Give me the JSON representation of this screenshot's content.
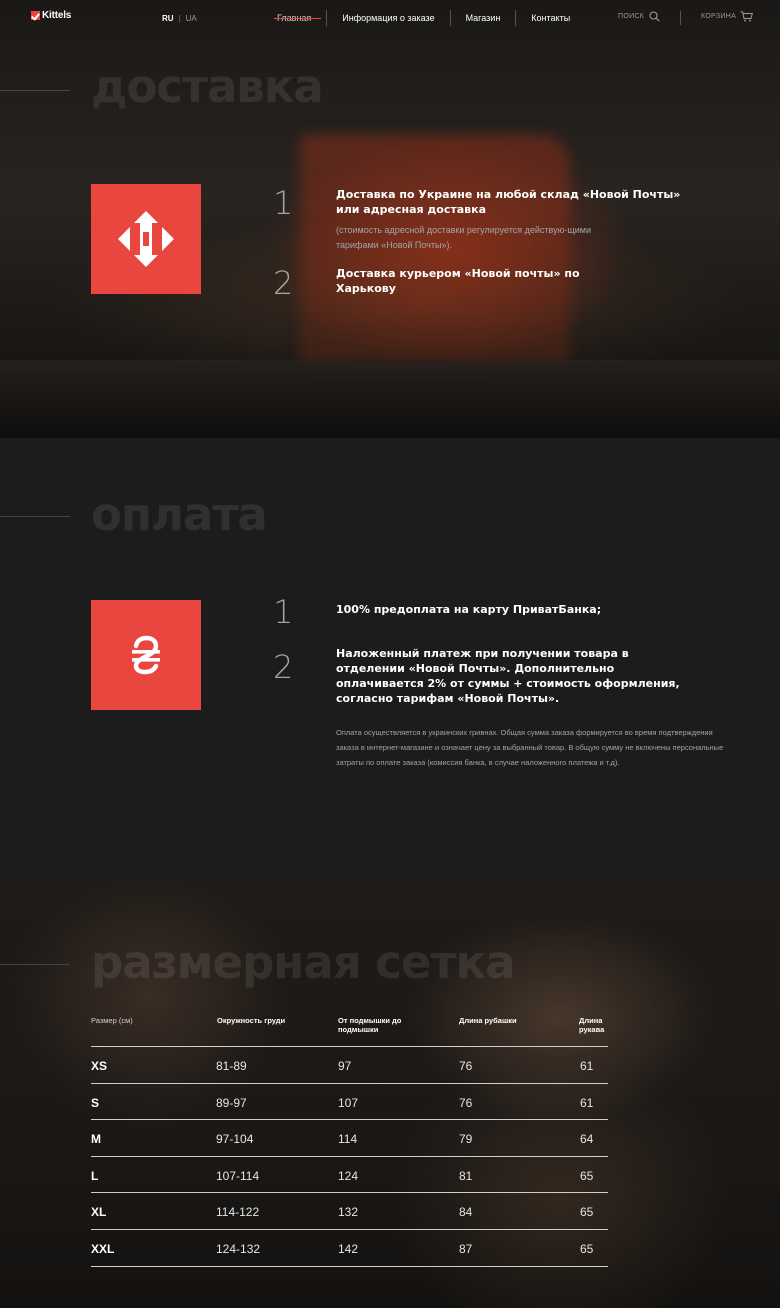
{
  "header": {
    "logo_text": "Kittels",
    "lang_active": "RU",
    "lang_inactive": "UA",
    "nav": [
      "Главная",
      "Информация о заказе",
      "Магазин",
      "Контакты"
    ],
    "search_label": "ПОИСК",
    "cart_label": "КОРЗИНА"
  },
  "delivery": {
    "title": "доставка",
    "icon": "nova-poshta-logo-icon",
    "items": [
      {
        "num": "1",
        "title": "Доставка по Украине на любой склад «Новой Почты» или адресная доставка",
        "note": "(стоимость адресной доставки регулируется действую-щими тарифами «Новой Почты»)."
      },
      {
        "num": "2",
        "title": "Доставка курьером «Новой почты» по Харькову"
      }
    ]
  },
  "payment": {
    "title": "оплата",
    "icon": "hryvnia-icon",
    "items": [
      {
        "num": "1",
        "title": "100% предоплата на карту ПриватБанка;"
      },
      {
        "num": "2",
        "title": "Наложенный платеж при получении товара в отделении «Новой Почты». Дополнительно оплачивается 2% от суммы + стоимость оформления, согласно тарифам «Новой Почты»."
      }
    ],
    "note": "Оплата осуществляется в украинских гривнах. Общая сумма заказа формируется во время подтверждения заказа в интернет-магазине и означает цену за выбранный товар. В общую сумму не включены персональные затраты по оплате заказа (комиссия банка, в случае наложенного платежа и т.д)."
  },
  "sizes": {
    "title": "размерная сетка",
    "headers": [
      "Размер (см)",
      "Окружность груди",
      "От подмышки до подмышки",
      "Длина рубашки",
      "Длина рукава"
    ],
    "rows": [
      [
        "XS",
        "81-89",
        "97",
        "76",
        "61"
      ],
      [
        "S",
        "89-97",
        "107",
        "76",
        "61"
      ],
      [
        "M",
        "97-104",
        "114",
        "79",
        "64"
      ],
      [
        "L",
        "107-114",
        "124",
        "81",
        "65"
      ],
      [
        "XL",
        "114-122",
        "132",
        "84",
        "65"
      ],
      [
        "XXL",
        "124-132",
        "142",
        "87",
        "65"
      ]
    ]
  },
  "colors": {
    "accent": "#e8463f",
    "background": "#1c1c1d"
  }
}
